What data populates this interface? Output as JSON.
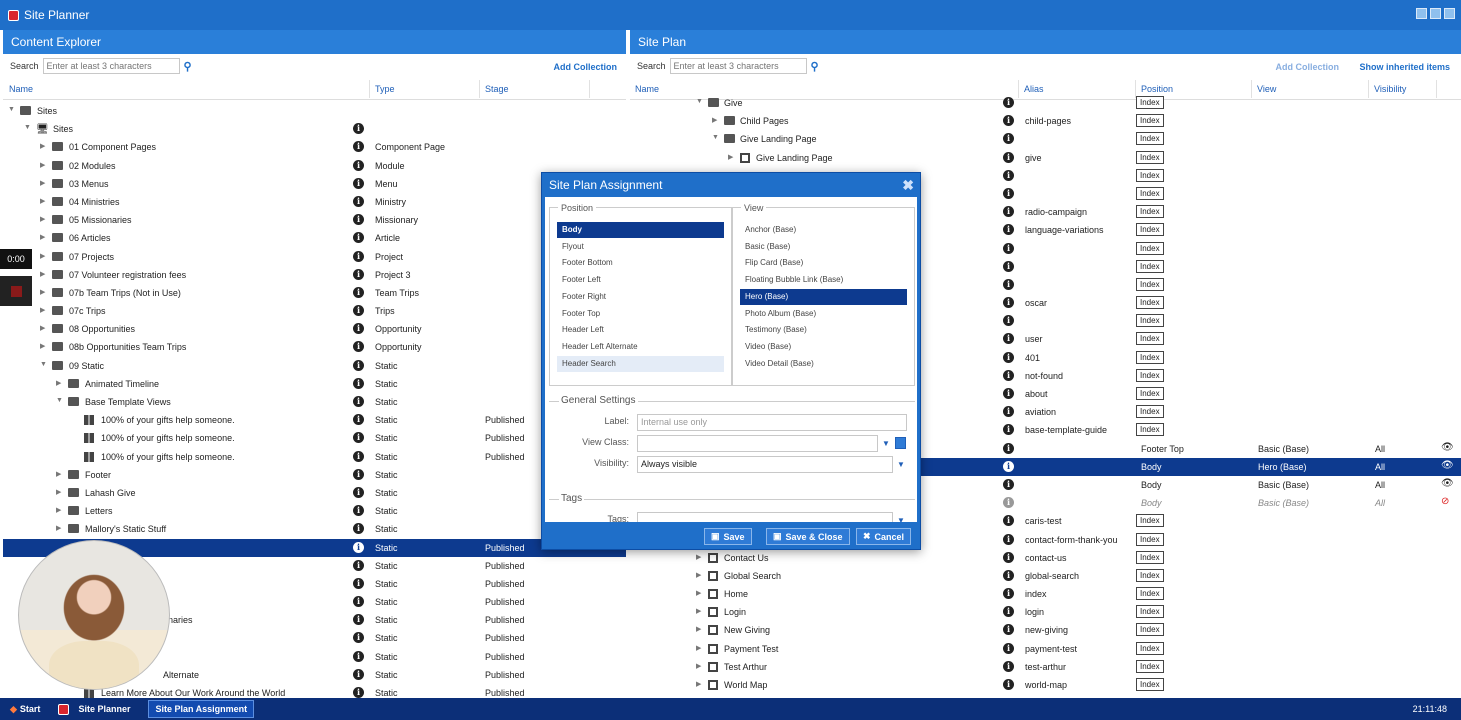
{
  "app": {
    "title": "Site Planner"
  },
  "left": {
    "title": "Content Explorer",
    "search_label": "Search",
    "search_placeholder": "Enter at least 3 characters",
    "add_collection": "Add Collection",
    "cols": [
      "Name",
      "Type",
      "Stage"
    ],
    "rows": [
      {
        "d": 0,
        "tri": "▼",
        "icon": "fold",
        "name": "Sites",
        "info": false,
        "type": "",
        "stage": ""
      },
      {
        "d": 1,
        "tri": "▼",
        "icon": "mon",
        "name": "Sites",
        "info": true,
        "type": "",
        "stage": ""
      },
      {
        "d": 2,
        "tri": "▶",
        "icon": "fold",
        "name": "01 Component Pages",
        "info": true,
        "type": "Component Page",
        "stage": ""
      },
      {
        "d": 2,
        "tri": "▶",
        "icon": "fold",
        "name": "02 Modules",
        "info": true,
        "type": "Module",
        "stage": ""
      },
      {
        "d": 2,
        "tri": "▶",
        "icon": "fold",
        "name": "03 Menus",
        "info": true,
        "type": "Menu",
        "stage": ""
      },
      {
        "d": 2,
        "tri": "▶",
        "icon": "fold",
        "name": "04 Ministries",
        "info": true,
        "type": "Ministry",
        "stage": ""
      },
      {
        "d": 2,
        "tri": "▶",
        "icon": "fold",
        "name": "05 Missionaries",
        "info": true,
        "type": "Missionary",
        "stage": ""
      },
      {
        "d": 2,
        "tri": "▶",
        "icon": "fold",
        "name": "06 Articles",
        "info": true,
        "type": "Article",
        "stage": ""
      },
      {
        "d": 2,
        "tri": "▶",
        "icon": "fold",
        "name": "07 Projects",
        "info": true,
        "type": "Project",
        "stage": ""
      },
      {
        "d": 2,
        "tri": "▶",
        "icon": "fold",
        "name": "07 Volunteer registration fees",
        "info": true,
        "type": "Project 3",
        "stage": ""
      },
      {
        "d": 2,
        "tri": "▶",
        "icon": "fold",
        "name": "07b Team Trips (Not in Use)",
        "info": true,
        "type": "Team Trips",
        "stage": ""
      },
      {
        "d": 2,
        "tri": "▶",
        "icon": "fold",
        "name": "07c Trips",
        "info": true,
        "type": "Trips",
        "stage": ""
      },
      {
        "d": 2,
        "tri": "▶",
        "icon": "fold",
        "name": "08 Opportunities",
        "info": true,
        "type": "Opportunity",
        "stage": ""
      },
      {
        "d": 2,
        "tri": "▶",
        "icon": "fold",
        "name": "08b Opportunities Team Trips",
        "info": true,
        "type": "Opportunity",
        "stage": ""
      },
      {
        "d": 2,
        "tri": "▼",
        "icon": "fold",
        "name": "09 Static",
        "info": true,
        "type": "Static",
        "stage": ""
      },
      {
        "d": 3,
        "tri": "▶",
        "icon": "fold",
        "name": "Animated Timeline",
        "info": true,
        "type": "Static",
        "stage": ""
      },
      {
        "d": 3,
        "tri": "▼",
        "icon": "fold",
        "name": "Base Template Views",
        "info": true,
        "type": "Static",
        "stage": ""
      },
      {
        "d": 4,
        "tri": "",
        "icon": "tile",
        "name": "100% of your gifts help someone.",
        "info": true,
        "type": "Static",
        "stage": "Published"
      },
      {
        "d": 4,
        "tri": "",
        "icon": "tile",
        "name": "100% of your gifts help someone.",
        "info": true,
        "type": "Static",
        "stage": "Published"
      },
      {
        "d": 4,
        "tri": "",
        "icon": "tile",
        "name": "100% of your gifts help someone.",
        "info": true,
        "type": "Static",
        "stage": "Published"
      },
      {
        "d": 3,
        "tri": "▶",
        "icon": "fold",
        "name": "Footer",
        "info": true,
        "type": "Static",
        "stage": ""
      },
      {
        "d": 3,
        "tri": "▶",
        "icon": "fold",
        "name": "Lahash Give",
        "info": true,
        "type": "Static",
        "stage": ""
      },
      {
        "d": 3,
        "tri": "▶",
        "icon": "fold",
        "name": "Letters",
        "info": true,
        "type": "Static",
        "stage": ""
      },
      {
        "d": 3,
        "tri": "▶",
        "icon": "fold",
        "name": "Mallory's Static Stuff",
        "info": true,
        "type": "Static",
        "stage": ""
      },
      {
        "d": 3,
        "tri": "",
        "icon": "",
        "name": "",
        "info": true,
        "type": "Static",
        "stage": "Published",
        "sel": true
      },
      {
        "d": 3,
        "tri": "",
        "icon": "",
        "name": "",
        "info": true,
        "type": "Static",
        "stage": "Published"
      },
      {
        "d": 3,
        "tri": "",
        "icon": "",
        "name": "",
        "info": true,
        "type": "Static",
        "stage": "Published"
      },
      {
        "d": 3,
        "tri": "",
        "icon": "",
        "name": "",
        "info": true,
        "type": "Static",
        "stage": "Published"
      },
      {
        "d": 3,
        "tri": "",
        "icon": "",
        "name": "onaries",
        "info": true,
        "type": "Static",
        "stage": "Published",
        "off": 160
      },
      {
        "d": 3,
        "tri": "",
        "icon": "",
        "name": "",
        "info": true,
        "type": "Static",
        "stage": "Published"
      },
      {
        "d": 3,
        "tri": "",
        "icon": "",
        "name": "",
        "info": true,
        "type": "Static",
        "stage": "Published"
      },
      {
        "d": 3,
        "tri": "",
        "icon": "",
        "name": "Alternate",
        "info": true,
        "type": "Static",
        "stage": "Published",
        "off": 160
      },
      {
        "d": 4,
        "tri": "",
        "icon": "tile",
        "name": "Learn More About Our Work Around the World",
        "info": true,
        "type": "Static",
        "stage": "Published"
      }
    ]
  },
  "right": {
    "title": "Site Plan",
    "search_label": "Search",
    "search_placeholder": "Enter at least 3 characters",
    "add_collection": "Add Collection",
    "show_inherited": "Show inherited items",
    "cols": [
      "Name",
      "Alias",
      "Position",
      "View",
      "Visibility"
    ],
    "rows": [
      {
        "d": 0,
        "tri": "▼",
        "icon": "fold",
        "name": "Give",
        "alias": "",
        "idx": "Index"
      },
      {
        "d": 1,
        "tri": "▶",
        "icon": "fold",
        "name": "Child Pages",
        "alias": "child-pages",
        "idx": "Index"
      },
      {
        "d": 1,
        "tri": "▼",
        "icon": "fold",
        "name": "Give Landing Page",
        "alias": "",
        "idx": "Index"
      },
      {
        "d": 2,
        "tri": "▶",
        "icon": "pg",
        "name": "Give Landing Page",
        "alias": "give",
        "idx": "Index"
      },
      {
        "d": 0,
        "name": "",
        "alias": "",
        "idx": "Index"
      },
      {
        "d": 0,
        "name": "",
        "alias": "",
        "idx": "Index"
      },
      {
        "d": 0,
        "name": "",
        "alias": "radio-campaign",
        "idx": "Index"
      },
      {
        "d": 0,
        "name": "",
        "alias": "language-variations",
        "idx": "Index"
      },
      {
        "d": 0,
        "name": "",
        "alias": "",
        "idx": "Index"
      },
      {
        "d": 0,
        "name": "",
        "alias": "",
        "idx": "Index"
      },
      {
        "d": 0,
        "name": "",
        "alias": "",
        "idx": "Index"
      },
      {
        "d": 0,
        "name": "",
        "alias": "oscar",
        "idx": "Index"
      },
      {
        "d": 0,
        "name": "",
        "alias": "",
        "idx": "Index"
      },
      {
        "d": 0,
        "name": "",
        "alias": "user",
        "idx": "Index"
      },
      {
        "d": 0,
        "name": "",
        "alias": "401",
        "idx": "Index"
      },
      {
        "d": 0,
        "name": "",
        "alias": "not-found",
        "idx": "Index"
      },
      {
        "d": 0,
        "name": "",
        "alias": "about",
        "idx": "Index"
      },
      {
        "d": 0,
        "name": "",
        "alias": "aviation",
        "idx": "Index"
      },
      {
        "d": 0,
        "name": "",
        "alias": "base-template-guide",
        "idx": "Index"
      },
      {
        "d": 0,
        "name": "",
        "alias": "",
        "pos": "Footer Top",
        "view": "Basic (Base)",
        "vis": "All",
        "eye": "👁"
      },
      {
        "d": 0,
        "name": "",
        "alias": "",
        "pos": "Body",
        "view": "Hero (Base)",
        "vis": "All",
        "eye": "👁",
        "sel": true
      },
      {
        "d": 0,
        "name": "",
        "alias": "",
        "pos": "Body",
        "view": "Basic (Base)",
        "vis": "All",
        "eye": "👁"
      },
      {
        "d": 0,
        "name": "",
        "alias": "",
        "pos": "Body",
        "view": "Basic (Base)",
        "vis": "All",
        "eye": "⊘",
        "muted": true
      },
      {
        "d": 0,
        "name": "",
        "alias": "caris-test",
        "idx": "Index"
      },
      {
        "d": 0,
        "name": "",
        "alias": "contact-form-thank-you",
        "idx": "Index"
      },
      {
        "d": 0,
        "tri": "▶",
        "icon": "pg",
        "name": "Contact Us",
        "alias": "contact-us",
        "idx": "Index"
      },
      {
        "d": 0,
        "tri": "▶",
        "icon": "pg",
        "name": "Global Search",
        "alias": "global-search",
        "idx": "Index"
      },
      {
        "d": 0,
        "tri": "▶",
        "icon": "pg",
        "name": "Home",
        "alias": "index",
        "idx": "Index"
      },
      {
        "d": 0,
        "tri": "▶",
        "icon": "pg",
        "name": "Login",
        "alias": "login",
        "idx": "Index"
      },
      {
        "d": 0,
        "tri": "▶",
        "icon": "pg",
        "name": "New Giving",
        "alias": "new-giving",
        "idx": "Index"
      },
      {
        "d": 0,
        "tri": "▶",
        "icon": "pg",
        "name": "Payment Test",
        "alias": "payment-test",
        "idx": "Index"
      },
      {
        "d": 0,
        "tri": "▶",
        "icon": "pg",
        "name": "Test Arthur",
        "alias": "test-arthur",
        "idx": "Index"
      },
      {
        "d": 0,
        "tri": "▶",
        "icon": "pg",
        "name": "World Map",
        "alias": "world-map",
        "idx": "Index"
      }
    ]
  },
  "dialog": {
    "title": "Site Plan Assignment",
    "position_label": "Position",
    "positions": [
      "Body",
      "Flyout",
      "Footer Bottom",
      "Footer Left",
      "Footer Right",
      "Footer Top",
      "Header Left",
      "Header Left Alternate",
      "Header Search"
    ],
    "position_selected": 0,
    "view_label": "View",
    "views": [
      "Anchor (Base)",
      "Basic (Base)",
      "Flip Card (Base)",
      "Floating Bubble Link (Base)",
      "Hero (Base)",
      "Photo Album (Base)",
      "Testimony (Base)",
      "Video (Base)",
      "Video Detail (Base)"
    ],
    "view_selected": 4,
    "general_settings": "General Settings",
    "label_label": "Label:",
    "label_placeholder": "Internal use only",
    "viewclass_label": "View Class:",
    "visibility_label": "Visibility:",
    "visibility_value": "Always visible",
    "tags_section": "Tags",
    "tags_label": "Tags:",
    "save": "Save",
    "save_close": "Save & Close",
    "cancel": "Cancel"
  },
  "recording": {
    "time": "0:00"
  },
  "taskbar": {
    "start": "Start",
    "item1": "Site Planner",
    "item2": "Site Plan Assignment",
    "clock": "21:11:48"
  },
  "colors": {
    "titlebar": "#1f6fc9",
    "selection": "#0d3a8f",
    "taskbar": "#0c2f78"
  }
}
